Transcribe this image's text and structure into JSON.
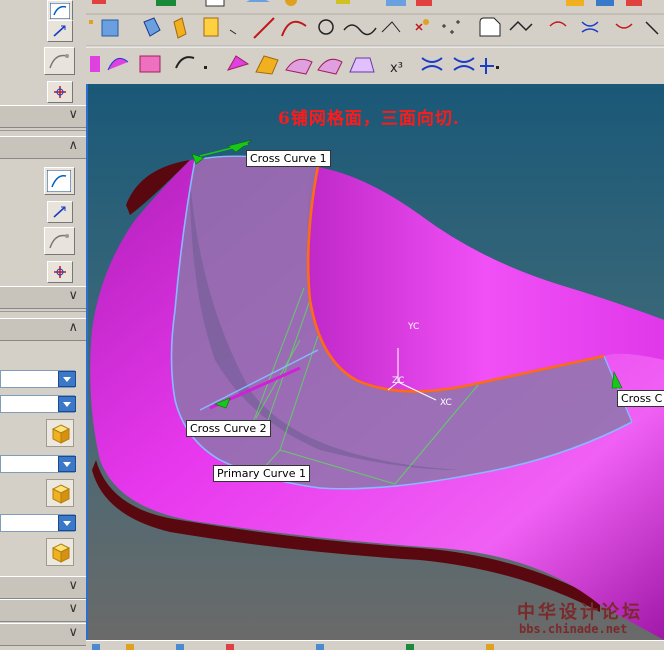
{
  "viewport": {
    "banner": "6铺网格面，三面向切.",
    "labels": {
      "cross_curve_1": "Cross Curve  1",
      "cross_curve_2": "Cross Curve  2",
      "cross_curve_3": "Cross C",
      "primary_curve_1": "Primary Curve  1"
    },
    "axes": {
      "yc": "YC",
      "zc": "ZC",
      "xc": "XC"
    },
    "colors": {
      "background_top": "#1e5a78",
      "background_bottom": "#5e6666",
      "surface": "#e23ee8",
      "patch": "#8a78a8",
      "edge_orange": "#ff6a14",
      "edge_blue": "#7aa8ff",
      "vector_green": "#18c818"
    }
  },
  "watermark": {
    "title": "中华设计论坛",
    "url": "bbs.chinade.net"
  },
  "toolbar": {
    "row1_icons": [
      "select-icon",
      "face-icon",
      "surface-icon",
      "extrude-icon",
      "line-icon",
      "arc-icon",
      "circle-icon",
      "spline-icon",
      "point-icon",
      "point-set-icon",
      "fillet-icon",
      "curve-options-icon",
      "offset-curve-icon",
      "bridge-icon",
      "trim-curve-icon"
    ],
    "row2_icons": [
      "shade-icon",
      "mesh-icon",
      "through-curves-icon",
      "swept-icon",
      "ruled-icon",
      "bounded-plane-icon",
      "n-sided-icon",
      "law-curve-icon",
      "x-cubed-icon",
      "project-icon",
      "intersect-icon",
      "split-icon"
    ]
  },
  "left_panel": {
    "sections": [
      "section-1",
      "section-2",
      "section-3",
      "section-4",
      "section-5",
      "section-6",
      "section-7"
    ]
  }
}
